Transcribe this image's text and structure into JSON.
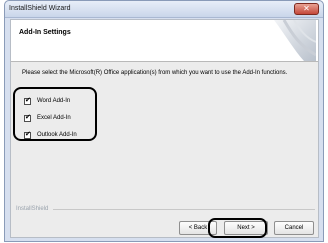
{
  "window": {
    "title": "InstallShield Wizard",
    "close_glyph": "✕"
  },
  "header": {
    "title": "Add-In Settings"
  },
  "instruction": "Please select the Microsoft(R) Office application(s) from which you want to use the Add-In functions.",
  "addins": [
    {
      "label": "Word Add-In",
      "checked": true,
      "mark": "✔"
    },
    {
      "label": "Excel Add-In",
      "checked": true,
      "mark": "✔"
    },
    {
      "label": "Outlook Add-In",
      "checked": true,
      "mark": "✔"
    }
  ],
  "footer": {
    "brand": "InstallShield"
  },
  "buttons": {
    "back": "< Back",
    "next": "Next >",
    "cancel": "Cancel"
  }
}
